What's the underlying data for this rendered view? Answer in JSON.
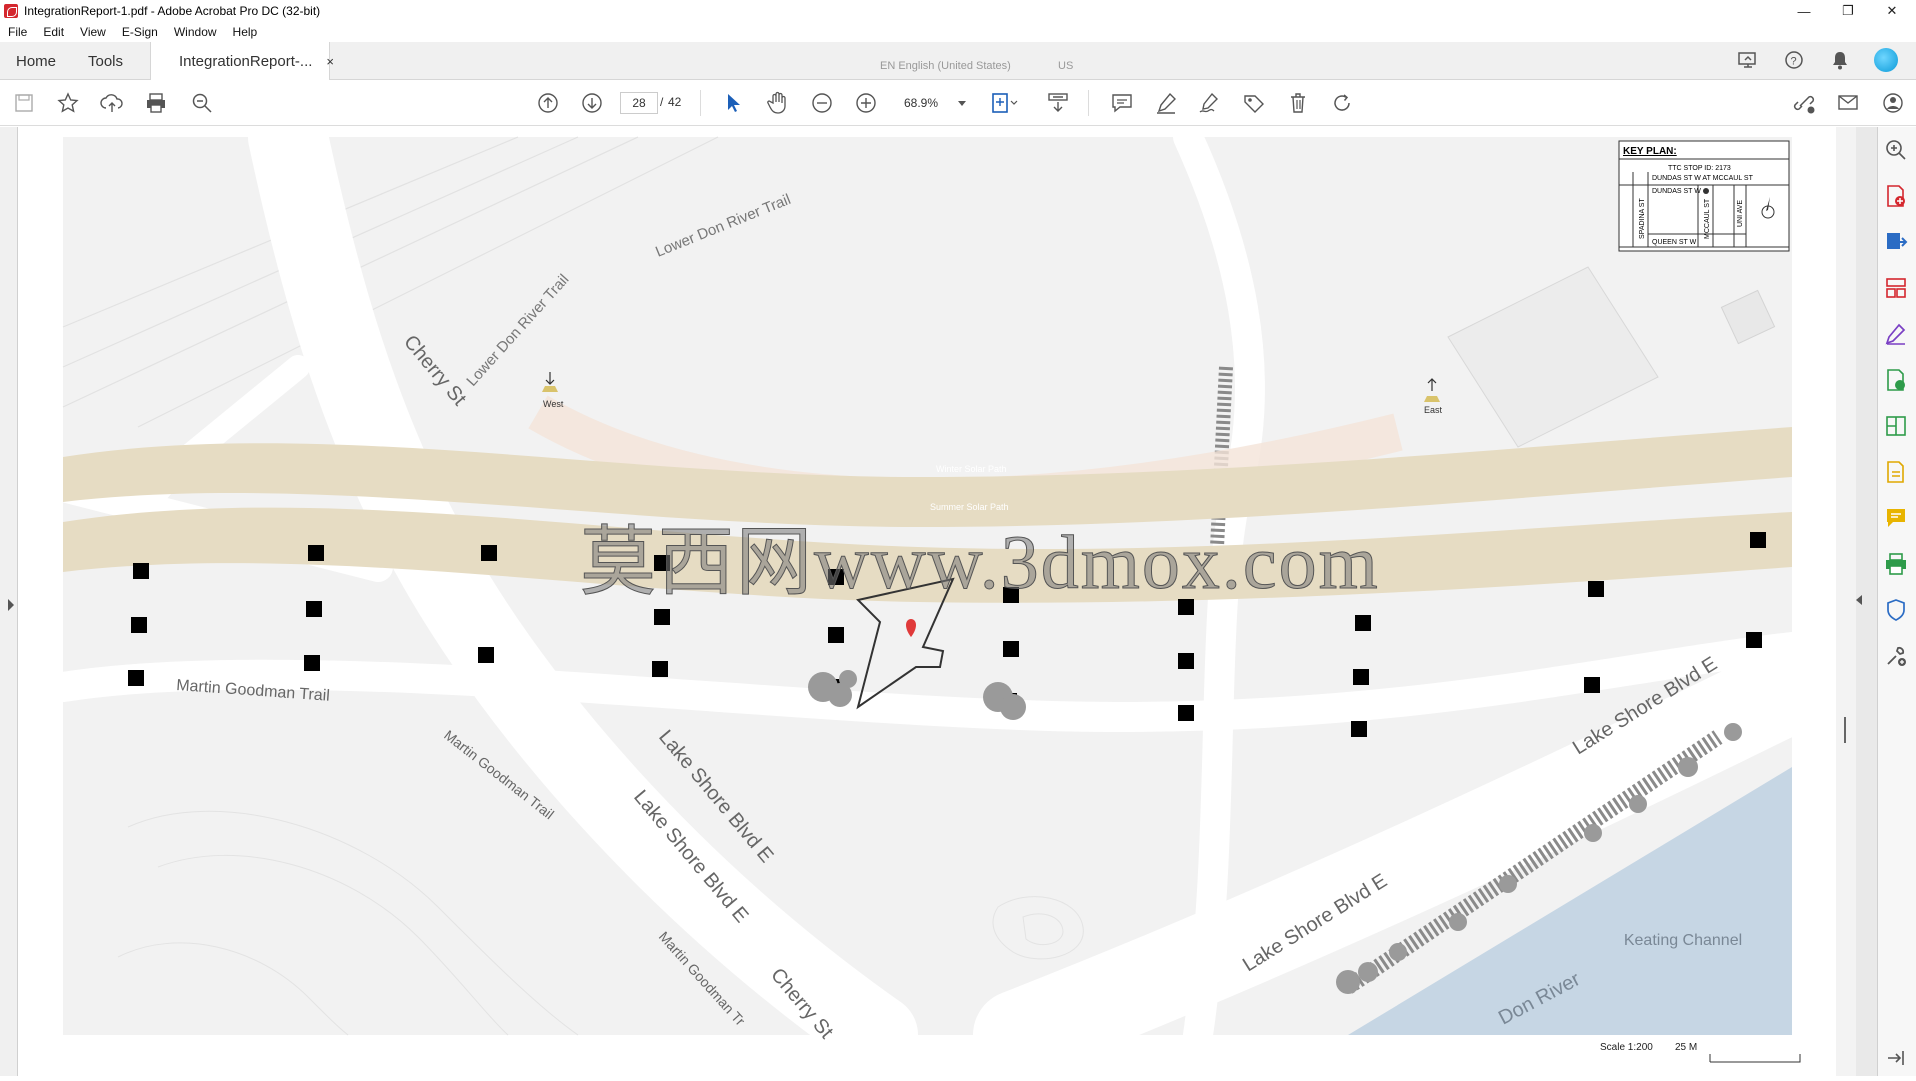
{
  "window": {
    "title": "IntegrationReport-1.pdf - Adobe Acrobat Pro DC (32-bit)",
    "controls": [
      "—",
      "❐",
      "✕"
    ]
  },
  "menu": [
    "File",
    "Edit",
    "View",
    "E-Sign",
    "Window",
    "Help"
  ],
  "tabs": {
    "home": "Home",
    "tools": "Tools",
    "document": "IntegrationReport-...",
    "close": "×"
  },
  "language": {
    "input": "EN English (United States)",
    "layout": "US"
  },
  "toolbar": {
    "current_page": "28",
    "separator": "/",
    "total_pages": "42",
    "zoom": "68.9%"
  },
  "map": {
    "key_plan": {
      "title": "KEY PLAN:",
      "stop": "TTC STOP ID: 2173",
      "location": "DUNDAS ST W AT MCCAUL ST",
      "streets": {
        "dundas": "DUNDAS ST W",
        "queen": "QUEEN ST W",
        "spadina": "SPADINA ST",
        "mccaul": "MCCAUL ST",
        "uni": "UNI AVE"
      }
    },
    "labels": {
      "trail1": "Lower Don River Trail",
      "trail2": "Lower Don River Trail",
      "cherry1": "Cherry St",
      "cherry2": "Cherry St",
      "martin1": "Martin Goodman Trail",
      "martin2": "Martin Goodman Trail",
      "martin3": "Martin Goodman Tr",
      "lakeshore1": "Lake Shore Blvd E",
      "lakeshore2": "Lake Shore Blvd E",
      "lakeshore3": "Lake Shore Blvd E",
      "lakeshore4": "Lake Shore Blvd E",
      "keating": "Keating Channel",
      "don": "Don River",
      "west": "West",
      "east": "East",
      "winter": "Winter Solar Path",
      "summer": "Summer Solar Path"
    },
    "scale": {
      "ratio": "Scale 1:200",
      "distance": "25 M"
    }
  },
  "watermark": "莫西网www.3dmox.com",
  "colors": {
    "road_band": "#e6dcc3",
    "map_bg": "#f2f2f2",
    "water": "#c6d6e4",
    "pin": "#e03a3a"
  }
}
